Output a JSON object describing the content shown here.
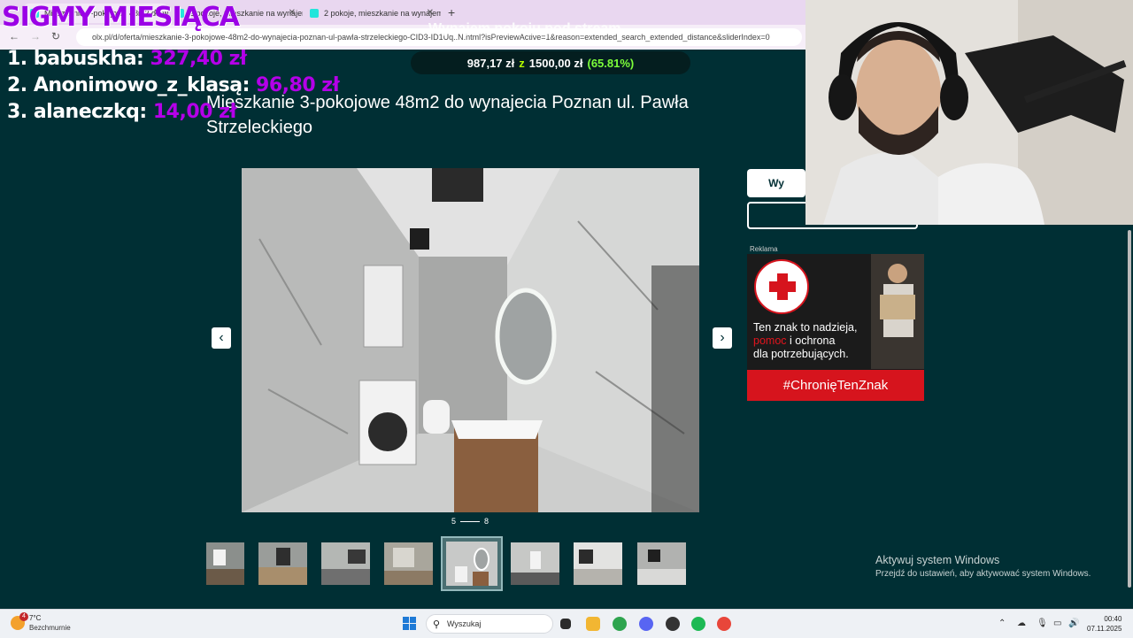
{
  "browser": {
    "tabs": [
      {
        "label": "Mieszkanie 3-pokojowe 48m2 do wynajecia"
      },
      {
        "label": "2 pokoje, mieszkanie na wynajem"
      },
      {
        "label": "2 pokoje, mieszkanie na wynajem"
      }
    ],
    "url": "olx.pl/d/oferta/mieszkanie-3-pokojowe-48m2-do-wynajecia-poznan-ul-pawla-strzeleckiego-CID3-ID1Uq..N.html?isPreviewActive=1&reason=extended_search_extended_distance&sliderIndex=0"
  },
  "overlay": {
    "sigmy_title": "SIGMY MIESIĄCA",
    "stream_title": "Wynajem pokoju pod stream",
    "goal": {
      "current": "987,17 zł",
      "sep": "z",
      "target": "1500,00 zł",
      "percent": "(65.81%)"
    },
    "ranking": [
      {
        "name": "1. babuskha:",
        "amount": "327,40 zł"
      },
      {
        "name": "2. Anonimowo_z_klasą:",
        "amount": "96,80 zł"
      },
      {
        "name": "3. alaneczkq:",
        "amount": "14,00 zł"
      }
    ]
  },
  "listing": {
    "title": "Mieszkanie 3-pokojowe 48m2 do wynajecia Poznan ul. Pawła Strzeleckiego",
    "gallery": {
      "current": "5",
      "total": "8",
      "prev_icon": "‹",
      "next_icon": "›"
    },
    "side_button_1": "Wy"
  },
  "ad": {
    "label": "Reklama",
    "text_1": "Ten znak to nadzieja,",
    "text_red": "pomoc",
    "text_2": " i ochrona",
    "text_3": "dla potrzebujących.",
    "tag": "#ChronięTenZnak"
  },
  "watermark": {
    "line1": "Aktywuj system Windows",
    "line2": "Przejdź do ustawień, aby aktywować system Windows."
  },
  "taskbar": {
    "weather_temp": "7°C",
    "weather_desc": "Bezchmurnie",
    "weather_badge": "4",
    "search_placeholder": "Wyszukaj",
    "time": "00:40",
    "date": "07.11.2025"
  },
  "colors": {
    "olx_bg": "#002f34",
    "accent_purple": "#9b00e6",
    "goal_green": "#7cff3a",
    "ad_red": "#d6141d"
  }
}
